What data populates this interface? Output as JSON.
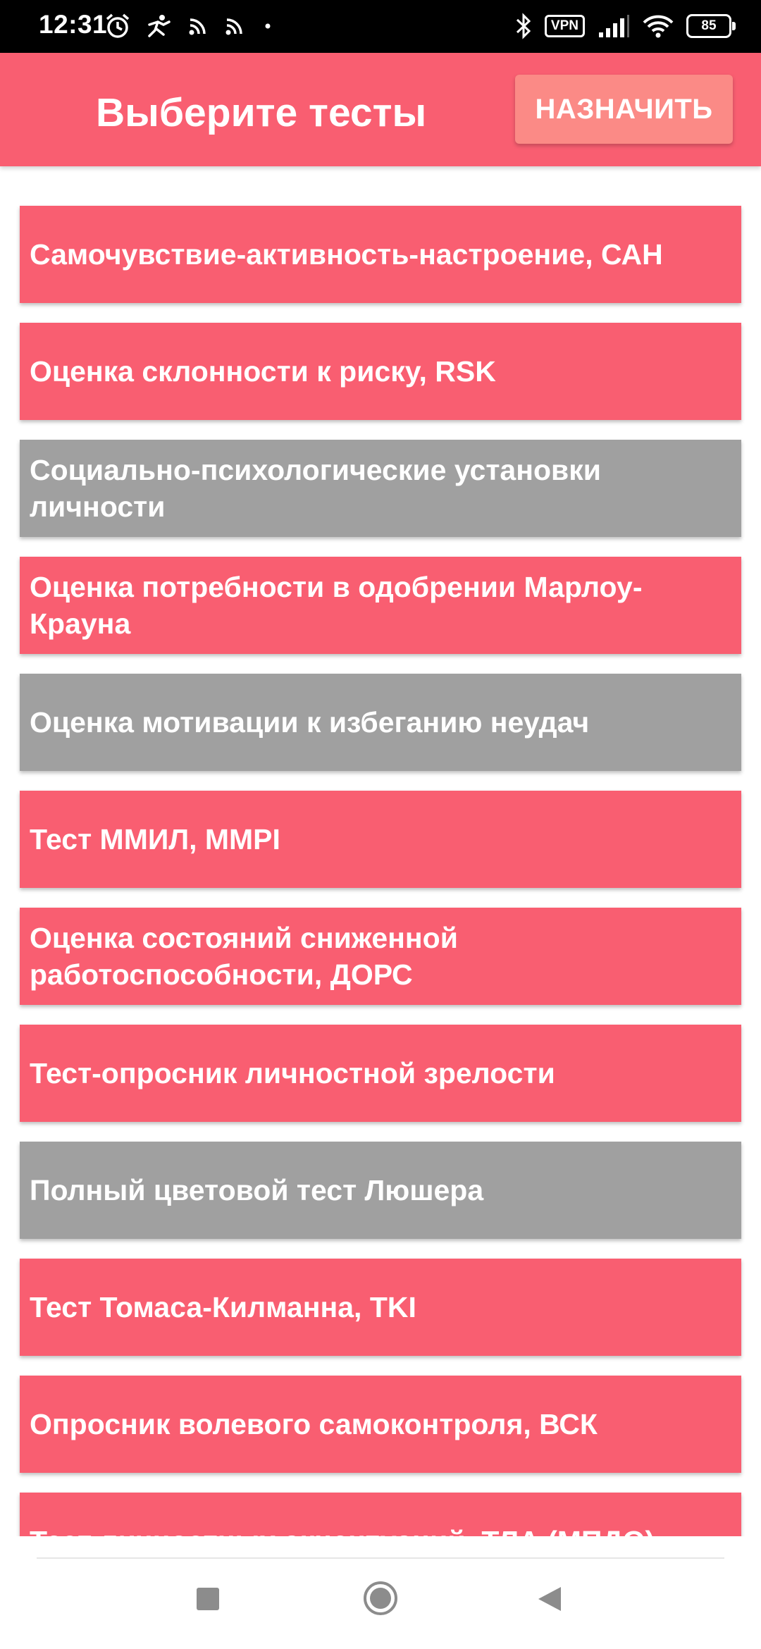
{
  "status_bar": {
    "time": "12:31",
    "vpn_label": "VPN",
    "battery_level": "85",
    "left_icons": [
      "alarm-icon",
      "activity-icon",
      "cast-icon",
      "cast-icon",
      "dot-icon"
    ],
    "right_icons": [
      "bluetooth-icon",
      "vpn-icon",
      "signal-icon",
      "wifi-icon",
      "battery-icon"
    ]
  },
  "app_bar": {
    "title": "Выберите тесты",
    "assign_button": "НАЗНАЧИТЬ",
    "color": "#f95e71",
    "button_color": "#fb8a86"
  },
  "tests": [
    {
      "label": "Самочувствие-активность-настроение, САН",
      "state": "active"
    },
    {
      "label": "Оценка склонности к риску, RSK",
      "state": "active"
    },
    {
      "label": "Социально-психологические установки личности",
      "state": "disabled"
    },
    {
      "label": "Оценка потребности в одобрении Марлоу-Крауна",
      "state": "active"
    },
    {
      "label": "Оценка мотивации к избеганию неудач",
      "state": "disabled"
    },
    {
      "label": "Тест ММИЛ, MMPI",
      "state": "active"
    },
    {
      "label": "Оценка состояний сниженной работоспособности, ДОРС",
      "state": "active"
    },
    {
      "label": "Тест-опросник личностной зрелости",
      "state": "active"
    },
    {
      "label": "Полный цветовой тест Люшера",
      "state": "disabled"
    },
    {
      "label": "Тест Томаса-Килманна, TKI",
      "state": "active"
    },
    {
      "label": "Опросник волевого самоконтроля, ВСК",
      "state": "active"
    },
    {
      "label": "Тест личностных акцентуаций, ТЛА (МПДО)",
      "state": "active"
    }
  ],
  "colors": {
    "active_item": "#f95e71",
    "disabled_item": "#a0a0a0"
  },
  "nav_bar": {
    "buttons": [
      "recents-square-icon",
      "home-circle-icon",
      "back-triangle-icon"
    ]
  }
}
